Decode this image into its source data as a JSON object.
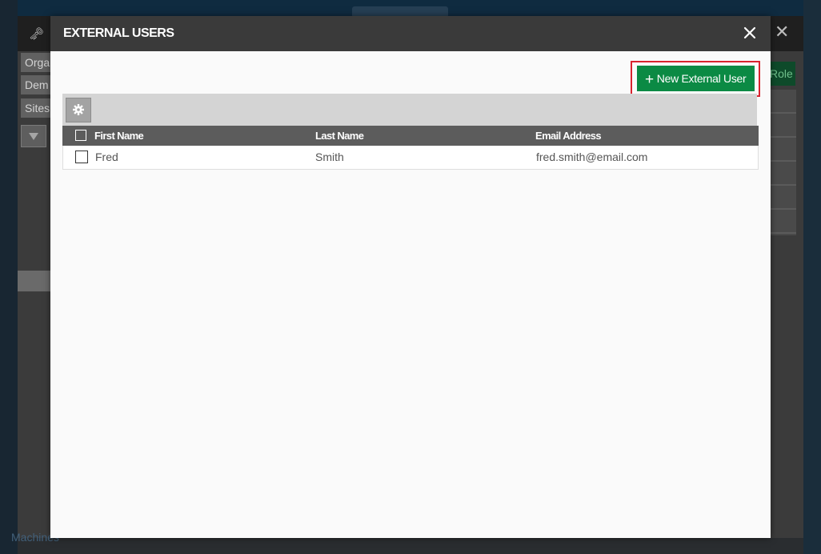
{
  "background": {
    "crumbs": [
      "Orga",
      "Dem",
      "Sites"
    ],
    "role_button": "Role",
    "footer_label": "Machines"
  },
  "modal": {
    "title": "EXTERNAL USERS",
    "close_icon": "close-icon",
    "new_button": {
      "icon": "plus-icon",
      "label": "New External User",
      "color": "#0b8a44",
      "highlight": "#d9232e"
    },
    "toolbar": {
      "settings_icon": "gear-icon"
    },
    "table": {
      "columns": [
        "First Name",
        "Last Name",
        "Email Address"
      ],
      "rows": [
        {
          "first_name": "Fred",
          "last_name": "Smith",
          "email": "fred.smith@email.com"
        }
      ]
    }
  }
}
